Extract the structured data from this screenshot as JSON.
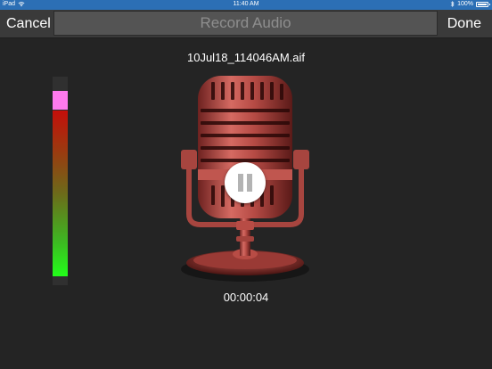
{
  "status_bar": {
    "device": "iPad",
    "time": "11:40 AM",
    "battery_percent": "100%"
  },
  "nav": {
    "cancel_label": "Cancel",
    "title": "Record Audio",
    "done_label": "Done"
  },
  "recording": {
    "filename": "10Jul18_114046AM.aif",
    "elapsed": "00:00:04",
    "level_fraction": 0.87,
    "peak_fraction": 0.93
  },
  "colors": {
    "status_bar": "#2c6fb5",
    "nav_bar": "#3a3a3a",
    "background": "#242424",
    "meter_peak": "#ff7aee",
    "meter_high": "#c40f0a",
    "meter_low": "#22ff1a",
    "microphone": "#c0504a"
  },
  "icons": {
    "wifi": "wifi-icon",
    "bluetooth": "bluetooth-icon",
    "battery": "battery-icon",
    "microphone": "microphone-icon",
    "pause": "pause-icon"
  }
}
